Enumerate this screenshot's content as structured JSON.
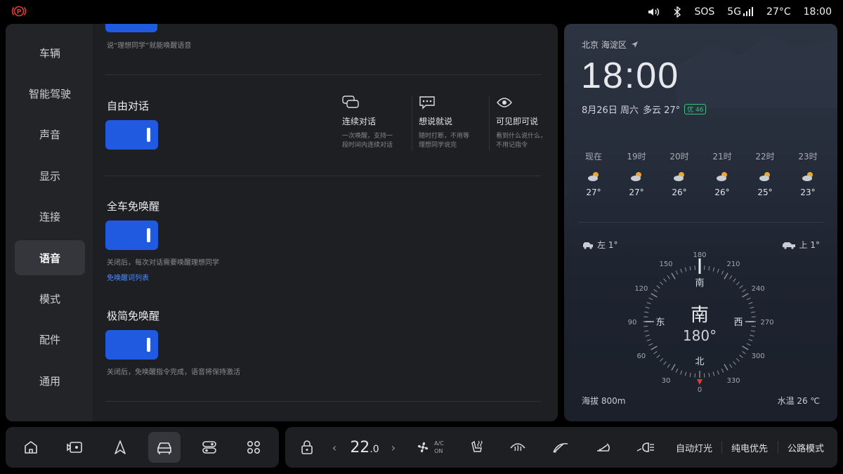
{
  "status_bar": {
    "park_icon": "parking-brake-icon",
    "sos": "SOS",
    "network": "5G",
    "temperature": "27°C",
    "time": "18:00"
  },
  "sidebar": {
    "items": [
      {
        "label": "车辆"
      },
      {
        "label": "智能驾驶"
      },
      {
        "label": "声音"
      },
      {
        "label": "显示"
      },
      {
        "label": "连接"
      },
      {
        "label": "语音",
        "active": true
      },
      {
        "label": "模式"
      },
      {
        "label": "配件"
      },
      {
        "label": "通用"
      }
    ]
  },
  "content": {
    "top_hint": "说“理想同学”就能唤醒语音",
    "free_dialog": {
      "title": "自由对话",
      "enabled": true,
      "features": [
        {
          "icon": "chat-bubbles-icon",
          "title": "连续对话",
          "desc1": "一次唤醒，支持一",
          "desc2": "段时间内连续对话"
        },
        {
          "icon": "message-dots-icon",
          "title": "想说就说",
          "desc1": "随时打断，不用等",
          "desc2": "理想同学说完"
        },
        {
          "icon": "eye-icon",
          "title": "可见即可说",
          "desc1": "看到什么说什么，",
          "desc2": "不用记指令"
        }
      ]
    },
    "no_wake_all": {
      "title": "全车免唤醒",
      "enabled": true,
      "hint": "关闭后，每次对话需要唤醒理想同学",
      "link": "免唤醒词列表"
    },
    "minimal_no_wake": {
      "title": "极简免唤醒",
      "enabled": true,
      "hint": "关闭后，免唤醒指令完成，语音将保持激活"
    }
  },
  "weather": {
    "location": "北京 海淀区",
    "time": "18:00",
    "date": "8月26日 周六",
    "condition": "多云 27°",
    "aqi": "优 46",
    "hourly": [
      {
        "label": "现在",
        "temp": "27°"
      },
      {
        "label": "19时",
        "temp": "27°"
      },
      {
        "label": "20时",
        "temp": "26°"
      },
      {
        "label": "21时",
        "temp": "26°"
      },
      {
        "label": "22时",
        "temp": "25°"
      },
      {
        "label": "23时",
        "temp": "23°"
      }
    ],
    "tilt_left": "左 1°",
    "tilt_up": "上 1°",
    "compass": {
      "heading_label": "南",
      "heading_deg": "180°",
      "heading_value": 180,
      "top_mark": "南",
      "left_mark": "东",
      "right_mark": "西",
      "bottom_mark": "北",
      "degree_labels": [
        "0",
        "30",
        "60",
        "90",
        "120",
        "150",
        "180",
        "210",
        "240",
        "270",
        "300",
        "330"
      ]
    },
    "altitude": "海拔 800m",
    "water_temp": "水温 26 ℃"
  },
  "dock_left": {
    "buttons": [
      "home-icon",
      "camera-icon",
      "navigation-icon",
      "car-icon",
      "toggle-icon",
      "apps-icon"
    ],
    "active_index": 3
  },
  "dock_right": {
    "temp_value": "22",
    "temp_decimal": ".0",
    "ac_label_top": "A/C",
    "ac_label_bottom": "ON",
    "auto_light": "自动灯光",
    "ev_priority": "纯电优先",
    "road_mode": "公路模式"
  }
}
